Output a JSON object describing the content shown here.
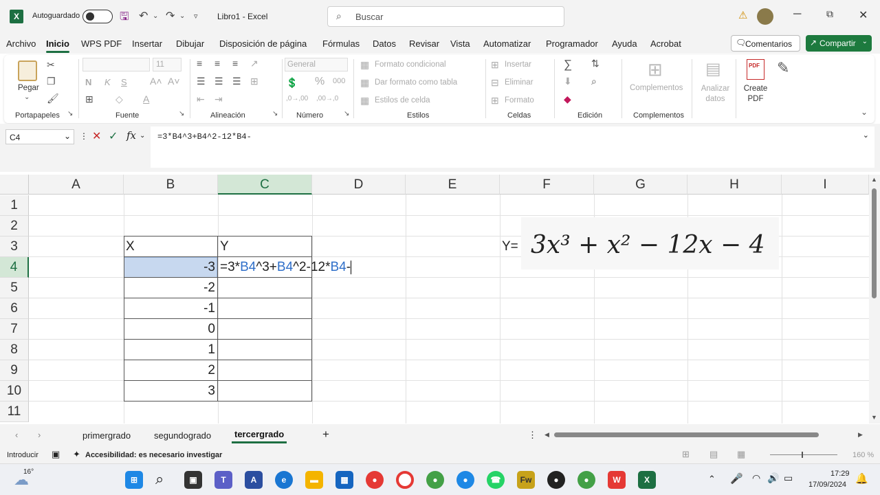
{
  "app": {
    "autosave_label": "Autoguardado",
    "title": "Libro1  -  Excel",
    "search_placeholder": "Buscar"
  },
  "menu": {
    "items": [
      "Archivo",
      "Inicio",
      "WPS PDF",
      "Insertar",
      "Dibujar",
      "Disposición de página",
      "Fórmulas",
      "Datos",
      "Revisar",
      "Vista",
      "Automatizar",
      "Programador",
      "Ayuda",
      "Acrobat"
    ],
    "active": "Inicio",
    "comments_label": "Comentarios",
    "share_label": "Compartir"
  },
  "ribbon": {
    "paste_label": "Pegar",
    "font_size": "11",
    "number_format": "General",
    "styles": {
      "conditional": "Formato condicional",
      "as_table": "Dar formato como tabla",
      "cell_styles": "Estilos de celda"
    },
    "cells": {
      "insert": "Insertar",
      "delete": "Eliminar",
      "format": "Formato"
    },
    "addins_label": "Complementos",
    "analyze_label": "Analizar datos",
    "create_pdf_label": "Create PDF",
    "groups": {
      "clipboard": "Portapapeles",
      "font": "Fuente",
      "alignment": "Alineación",
      "number": "Número",
      "styles": "Estilos",
      "cells": "Celdas",
      "editing": "Edición",
      "addins": "Complementos"
    },
    "font_buttons": {
      "bold": "N",
      "italic": "K",
      "underline": "S"
    }
  },
  "formula_bar": {
    "name_box": "C4",
    "formula": "=3*B4^3+B4^2-12*B4-"
  },
  "sheet": {
    "columns": [
      "A",
      "B",
      "C",
      "D",
      "E",
      "F",
      "G",
      "H",
      "I"
    ],
    "rows": [
      "1",
      "2",
      "3",
      "4",
      "5",
      "6",
      "7",
      "8",
      "9",
      "10",
      "11"
    ],
    "header_x": "X",
    "header_y": "Y",
    "x_values": [
      "-3",
      "-2",
      "-1",
      "0",
      "1",
      "2",
      "3"
    ],
    "editing": {
      "p1": "=3*",
      "r1": "B4",
      "p2": "^3+",
      "r2": "B4",
      "p3": "^2-12*",
      "r3": "B4",
      "p4": "-"
    },
    "y_label": "Y=",
    "equation": "3x³ + x² − 12x − 4"
  },
  "tabs": {
    "sheets": [
      "primergrado",
      "segundogrado",
      "tercergrado"
    ],
    "active": "tercergrado",
    "add": "+"
  },
  "status": {
    "mode": "Introducir",
    "accessibility": "Accesibilidad: es necesario investigar",
    "zoom": "160 %"
  },
  "taskbar": {
    "temperature": "16°",
    "time": "17:29",
    "date": "17/09/2024"
  },
  "colors": {
    "excel_green": "#1d6f42",
    "reference_blue": "#2f6fc9",
    "selection": "#c7d8ef"
  }
}
